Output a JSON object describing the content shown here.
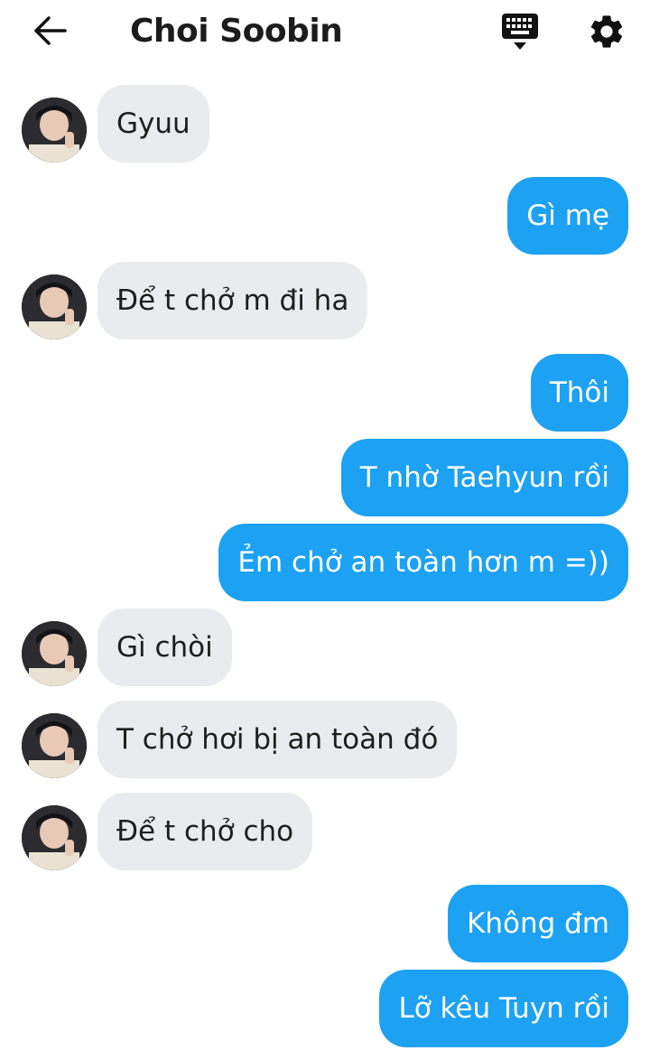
{
  "header": {
    "title": "Choi Soobin",
    "back_icon": "arrow-left-icon",
    "keyboard_icon": "keyboard-icon",
    "settings_icon": "gear-icon"
  },
  "colors": {
    "outgoing_bubble": "#1da1f2",
    "incoming_bubble": "#e9ebee"
  },
  "messages": [
    {
      "from": "them",
      "text": "Gyuu"
    },
    {
      "from": "me",
      "text": "Gì mẹ"
    },
    {
      "from": "them",
      "text": "Để t chở m đi ha"
    },
    {
      "from": "me",
      "text": "Thôi"
    },
    {
      "from": "me",
      "text": "T nhờ Taehyun rồi"
    },
    {
      "from": "me",
      "text": "Ẻm chở an toàn hơn m =))"
    },
    {
      "from": "them",
      "text": "Gì chòi"
    },
    {
      "from": "them",
      "text": "T chở hơi bị an toàn đó"
    },
    {
      "from": "them",
      "text": "Để t chở cho"
    },
    {
      "from": "me",
      "text": "Không đm"
    },
    {
      "from": "me",
      "text": "Lỡ kêu Tuyn rồi"
    }
  ]
}
